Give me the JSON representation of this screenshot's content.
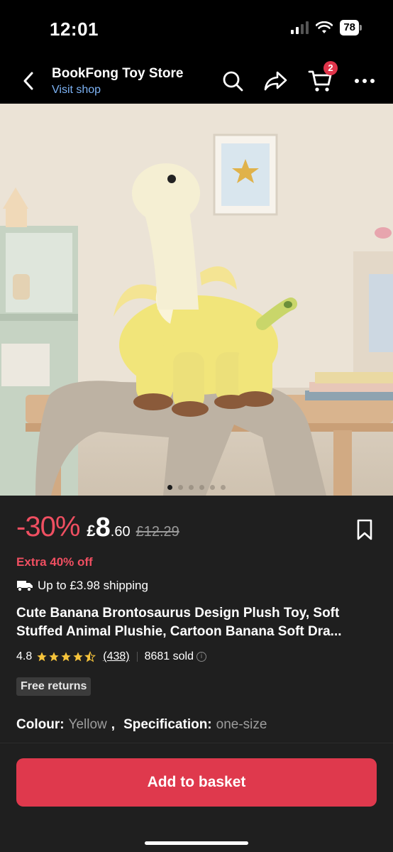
{
  "status_bar": {
    "time": "12:01",
    "battery": "78"
  },
  "header": {
    "shop_name": "BookFong Toy Store",
    "visit_shop": "Visit shop",
    "cart_count": "2",
    "icons": [
      "back-arrow-icon",
      "search-icon",
      "share-icon",
      "cart-icon",
      "more-icon"
    ]
  },
  "gallery": {
    "image_description_icon": "product-photo",
    "total_images": 6,
    "active_index": 0
  },
  "product": {
    "discount": "-30%",
    "currency": "£",
    "price_main": "8",
    "price_decimal": ".60",
    "original_price": "£12.29",
    "extra_off": "Extra 40% off",
    "shipping": "Up to £3.98 shipping",
    "title_line1": "Cute Banana Brontosaurus Design Plush Toy, Soft",
    "title_line2": "Stuffed Animal Plushie, Cartoon Banana Soft Dra...",
    "rating": "4.8",
    "rating_stars": 4.5,
    "review_count": "(438)",
    "sold": "8681 sold",
    "badge": "Free returns",
    "colour_label": "Colour:",
    "colour_value": "Yellow",
    "spec_label": "Specification:",
    "spec_value": "one-size"
  },
  "actions": {
    "add_to_basket": "Add to basket"
  },
  "colors": {
    "accent": "#df394d",
    "discount_red": "#ef4f61",
    "link_blue": "#7db3f5",
    "panel_bg": "#1f1f1f"
  }
}
